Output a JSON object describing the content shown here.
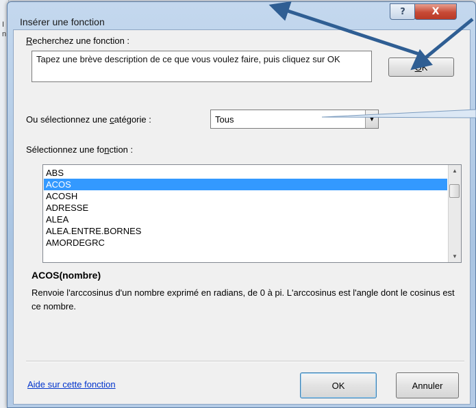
{
  "background": {
    "letters": [
      "I",
      "n"
    ]
  },
  "window": {
    "title": "Insérer une fonction",
    "help_glyph": "?",
    "close_glyph": "X"
  },
  "search": {
    "label_prefix": "",
    "label_accel": "R",
    "label_rest": "echerchez une fonction :",
    "description": "Tapez une brève description de ce que vous voulez faire, puis cliquez sur OK",
    "ok_accel": "O",
    "ok_rest": "K"
  },
  "category": {
    "label_prefix": "Ou sélectionnez une ",
    "label_accel": "c",
    "label_rest": "atégorie :",
    "selected": "Tous",
    "arrow_glyph": "▼"
  },
  "functions": {
    "label_prefix": "Sélectionnez une fo",
    "label_accel": "n",
    "label_rest": "ction :",
    "items": [
      "ABS",
      "ACOS",
      "ACOSH",
      "ADRESSE",
      "ALEA",
      "ALEA.ENTRE.BORNES",
      "AMORDEGRC"
    ],
    "selected_index": 1,
    "scroll_up": "▲",
    "scroll_down": "▼"
  },
  "details": {
    "signature": "ACOS(nombre)",
    "description": "Renvoie l'arccosinus d'un nombre exprimé en radians, de 0 à pi. L'arccosinus est l'angle dont le cosinus est ce nombre."
  },
  "footer": {
    "help_link": "Aide sur cette fonction",
    "ok_label": "OK",
    "cancel_label": "Annuler"
  },
  "colors": {
    "selection": "#3399ff",
    "link": "#0033cc",
    "arrow": "#2f5e93"
  }
}
